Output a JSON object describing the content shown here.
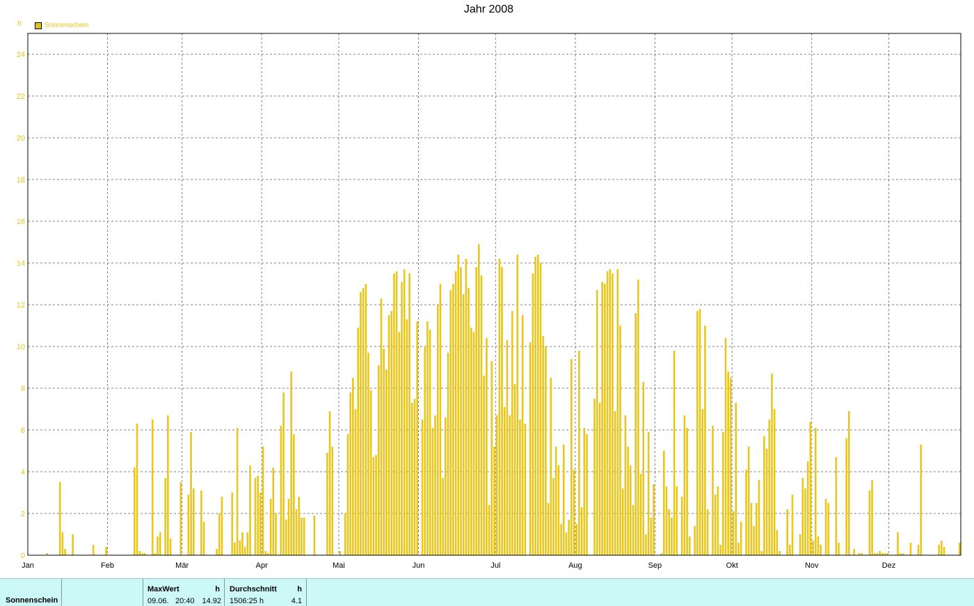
{
  "chart_data": {
    "type": "bar",
    "title": "Jahr 2008",
    "ylabel": "h",
    "xlabel": "",
    "ylim": [
      0,
      25
    ],
    "yticks": [
      0,
      2,
      4,
      6,
      8,
      10,
      12,
      14,
      16,
      18,
      20,
      22,
      24
    ],
    "months": [
      "Jan",
      "Feb",
      "Mär",
      "Apr",
      "Mai",
      "Jun",
      "Jul",
      "Aug",
      "Sep",
      "Okt",
      "Nov",
      "Dez"
    ],
    "grid": true,
    "legend_position": "top-left",
    "series": [
      {
        "name": "Sonnenschein",
        "color": "#e8c61a",
        "values": [
          0,
          0,
          0,
          0,
          0,
          0,
          0,
          0.1,
          0,
          0,
          0,
          0,
          3.5,
          1.1,
          0.3,
          0,
          0,
          1.0,
          0,
          0,
          0,
          0,
          0,
          0,
          0,
          0.5,
          0,
          0,
          0,
          0,
          0.4,
          0,
          0,
          0,
          0,
          0,
          0,
          0,
          0,
          0,
          0,
          4.2,
          6.3,
          0.2,
          0.1,
          0.1,
          0,
          0,
          6.5,
          0.1,
          0.9,
          1.1,
          0,
          3.7,
          6.7,
          0.8,
          0,
          0,
          0,
          3.5,
          0,
          0,
          2.9,
          5.9,
          3.2,
          0,
          0,
          3.1,
          1.6,
          0,
          0,
          0,
          0,
          0.3,
          2.0,
          2.8,
          0,
          0,
          0,
          3.0,
          0.6,
          6.1,
          0.7,
          1.1,
          0.4,
          1.1,
          4.3,
          0,
          3.7,
          3.8,
          3.0,
          5.2,
          0.2,
          0.1,
          2.7,
          4.2,
          2.0,
          0,
          6.2,
          7.8,
          1.7,
          2.7,
          8.8,
          5.8,
          2.2,
          2.8,
          1.8,
          1.8,
          0,
          0,
          0,
          1.9,
          0,
          0,
          0,
          0,
          4.9,
          6.9,
          5.2,
          0,
          0,
          0.2,
          0,
          2.0,
          5.8,
          7.8,
          8.5,
          7.0,
          10.9,
          12.6,
          12.8,
          13.0,
          9.7,
          7.9,
          4.7,
          4.8,
          9.1,
          12.3,
          9.9,
          8.9,
          11.5,
          11.7,
          13.5,
          13.6,
          10.7,
          13.1,
          13.7,
          11.3,
          13.5,
          7.3,
          7.5,
          11.2,
          0,
          6.5,
          10.0,
          11.2,
          10.8,
          6.1,
          6.7,
          12.0,
          13.0,
          3.7,
          6.6,
          9.7,
          12.7,
          13.0,
          13.6,
          14.4,
          13.8,
          12.5,
          14.2,
          12.8,
          10.9,
          10.7,
          13.8,
          14.9,
          13.4,
          8.6,
          10.4,
          2.4,
          9.3,
          5.2,
          6.7,
          14.2,
          13.8,
          7.1,
          10.3,
          6.7,
          11.7,
          8.2,
          14.4,
          6.5,
          11.5,
          6.3,
          0,
          10.2,
          13.5,
          14.3,
          14.4,
          14.0,
          10.5,
          10.0,
          2.5,
          8.5,
          3.7,
          5.2,
          4.3,
          1.5,
          5.3,
          1.1,
          1.7,
          9.4,
          4.1,
          1.5,
          9.8,
          2.3,
          6.1,
          5.8,
          0,
          0,
          7.5,
          12.7,
          7.3,
          13.1,
          13.0,
          13.6,
          13.7,
          13.5,
          6.9,
          13.7,
          11.0,
          3.2,
          6.7,
          5.2,
          4.3,
          2.4,
          11.6,
          13.2,
          3.9,
          8.3,
          1.0,
          5.9,
          1.8,
          3.4,
          0,
          0,
          0.1,
          5.0,
          3.3,
          2.2,
          1.8,
          9.8,
          3.3,
          0,
          2.8,
          6.7,
          6.1,
          0.9,
          0,
          1.4,
          11.7,
          11.8,
          7.0,
          11.0,
          2.2,
          0,
          6.2,
          2.9,
          3.3,
          0.5,
          5.9,
          10.4,
          8.8,
          8.5,
          2.1,
          7.3,
          0.6,
          1.6,
          0,
          4.1,
          5.2,
          2.5,
          1.4,
          2.5,
          3.6,
          0.2,
          5.7,
          5.1,
          6.5,
          8.7,
          7.0,
          1.2,
          0.2,
          0,
          0,
          2.2,
          0.5,
          2.9,
          0,
          0,
          1.0,
          3.7,
          3.2,
          4.5,
          6.4,
          0.7,
          6.1,
          0.9,
          0.5,
          0,
          2.7,
          2.5,
          0,
          0,
          4.7,
          0.6,
          0,
          0,
          5.6,
          6.9,
          0,
          0.3,
          0,
          0.1,
          0.1,
          0,
          0,
          3.1,
          3.6,
          0.1,
          0.1,
          0.2,
          0.1,
          0.1,
          0.1,
          0,
          0,
          0,
          1.1,
          0.1,
          0.1,
          0,
          0,
          0.6,
          0,
          0,
          0.5,
          5.3,
          0,
          0,
          0,
          0,
          0,
          0,
          0.5,
          0.7,
          0.4,
          0,
          0,
          0,
          0,
          0,
          0.6
        ]
      }
    ]
  },
  "stats": {
    "row_label": "Sonnenschein",
    "max_header": "MaxWert",
    "max_unit": "h",
    "max_date": "09.06.",
    "max_time": "20:40",
    "max_value": "14.92",
    "avg_header": "Durchschnitt",
    "avg_unit": "h",
    "avg_total": "1506:25 h",
    "avg_value": "4.1"
  }
}
